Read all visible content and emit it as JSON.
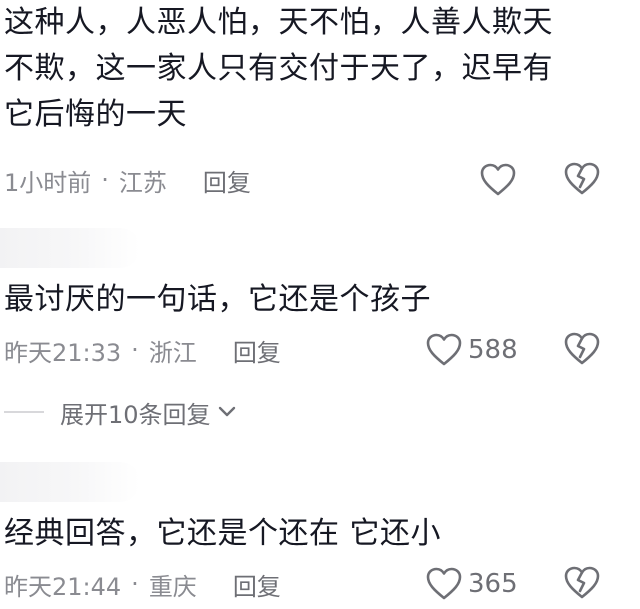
{
  "comments": [
    {
      "text_lines": [
        "这种人，人恶人怕，天不怕，人善人欺天",
        "不欺，这一家人只有交付于天了，迟早有",
        "它后悔的一天"
      ],
      "time": "1小时前",
      "location": "江苏",
      "reply_label": "回复",
      "likes": ""
    },
    {
      "text_lines": [
        "最讨厌的一句话，它还是个孩子"
      ],
      "time": "昨天21:33",
      "location": "浙江",
      "reply_label": "回复",
      "likes": "588"
    },
    {
      "text_lines": [
        "经典回答，它还是个还在 它还小"
      ],
      "time": "昨天21:44",
      "location": "重庆",
      "reply_label": "回复",
      "likes": "365"
    }
  ],
  "separator": "·",
  "expand_replies_label": "展开10条回复",
  "icons": {
    "like": "heart-outline-icon",
    "dislike": "broken-heart-icon",
    "expand": "chevron-down-icon"
  },
  "colors": {
    "text": "#161823",
    "meta": "#8a8b91",
    "icon": "#6e6f75"
  }
}
